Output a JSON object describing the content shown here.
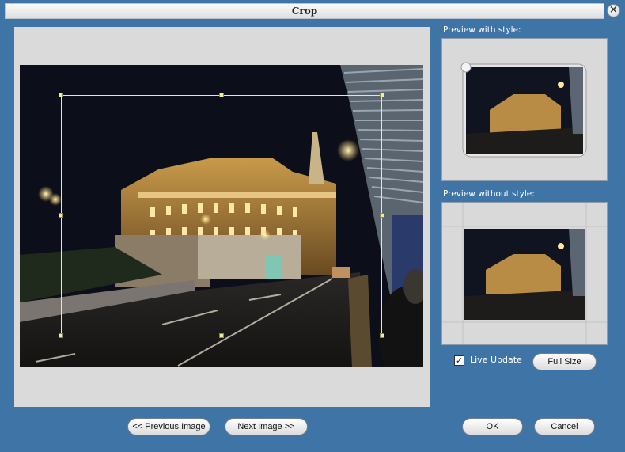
{
  "window": {
    "title": "Crop"
  },
  "icons": {
    "close": "close-icon",
    "check": "checkmark-icon"
  },
  "previews": {
    "with_style_label": "Preview with style:",
    "without_style_label": "Preview without style:"
  },
  "options": {
    "live_update_label": "Live Update",
    "live_update_checked": true
  },
  "buttons": {
    "full_size": "Full Size",
    "previous": "<< Previous Image",
    "next": "Next Image >>",
    "ok": "OK",
    "cancel": "Cancel"
  },
  "colors": {
    "frame": "#3f74a7",
    "panel": "#dadada",
    "crop_border": "#f0f07a"
  }
}
